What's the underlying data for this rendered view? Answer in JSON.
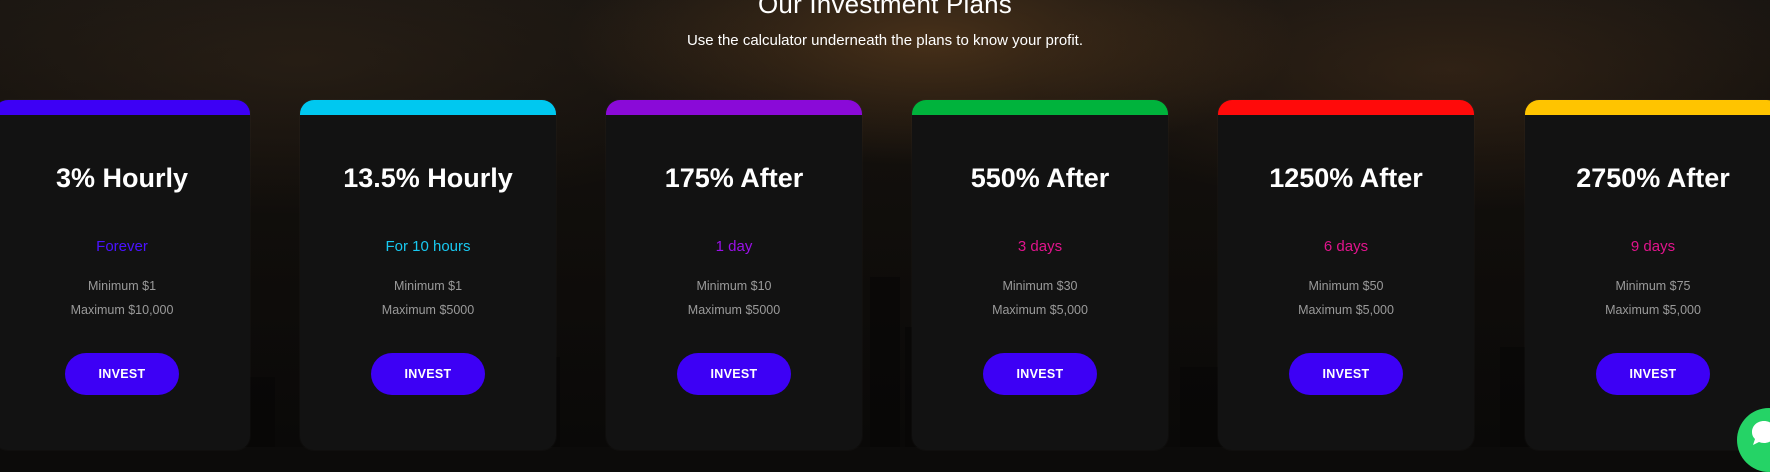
{
  "header": {
    "title": "Our Investment Plans",
    "subtitle": "Use the calculator underneath the plans to know your profit."
  },
  "plans": [
    {
      "title": "3% Hourly",
      "duration": "Forever",
      "minimum": "Minimum $1",
      "maximum": "Maximum $10,000",
      "button": "INVEST",
      "accent": "#3d00f5",
      "duration_color": "#4a12ff"
    },
    {
      "title": "13.5% Hourly",
      "duration": "For 10 hours",
      "minimum": "Minimum $1",
      "maximum": "Maximum $5000",
      "button": "INVEST",
      "accent": "#00c8f0",
      "duration_color": "#18c8f0"
    },
    {
      "title": "175% After",
      "duration": "1 day",
      "minimum": "Minimum $10",
      "maximum": "Maximum $5000",
      "button": "INVEST",
      "accent": "#8a0ad8",
      "duration_color": "#9a10e8"
    },
    {
      "title": "550% After",
      "duration": "3 days",
      "minimum": "Minimum $30",
      "maximum": "Maximum $5,000",
      "button": "INVEST",
      "accent": "#00b33c",
      "duration_color": "#e0148c"
    },
    {
      "title": "1250% After",
      "duration": "6 days",
      "minimum": "Minimum $50",
      "maximum": "Maximum $5,000",
      "button": "INVEST",
      "accent": "#ff0a0a",
      "duration_color": "#e0148c"
    },
    {
      "title": "2750% After",
      "duration": "9 days",
      "minimum": "Minimum $75",
      "maximum": "Maximum $5,000",
      "button": "INVEST",
      "accent": "#ffc400",
      "duration_color": "#e0148c"
    }
  ],
  "chat_widget": {
    "icon": "chat-bubble-icon",
    "color": "#25d366"
  }
}
